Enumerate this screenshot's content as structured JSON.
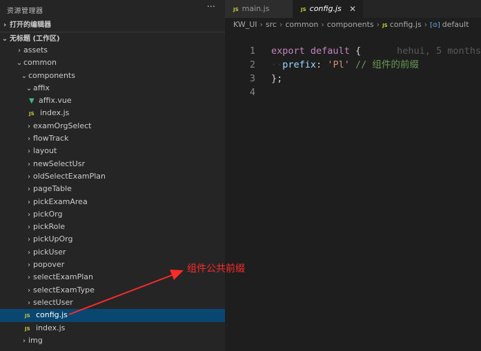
{
  "sidebar": {
    "title": "资源管理器",
    "more_label": "···",
    "open_editors": "打开的编辑器",
    "workspace": "无标题 (工作区)",
    "tree": [
      {
        "label": "assets",
        "kind": "folder",
        "depth": 1,
        "expanded": false
      },
      {
        "label": "common",
        "kind": "folder",
        "depth": 1,
        "expanded": true
      },
      {
        "label": "components",
        "kind": "folder",
        "depth": 2,
        "expanded": true
      },
      {
        "label": "affix",
        "kind": "folder",
        "depth": 3,
        "expanded": true
      },
      {
        "label": "affix.vue",
        "kind": "vue",
        "depth": 4
      },
      {
        "label": "index.js",
        "kind": "js",
        "depth": 4
      },
      {
        "label": "examOrgSelect",
        "kind": "folder",
        "depth": 3,
        "expanded": false
      },
      {
        "label": "flowTrack",
        "kind": "folder",
        "depth": 3,
        "expanded": false
      },
      {
        "label": "layout",
        "kind": "folder",
        "depth": 3,
        "expanded": false
      },
      {
        "label": "newSelectUsr",
        "kind": "folder",
        "depth": 3,
        "expanded": false
      },
      {
        "label": "oldSelectExamPlan",
        "kind": "folder",
        "depth": 3,
        "expanded": false
      },
      {
        "label": "pageTable",
        "kind": "folder",
        "depth": 3,
        "expanded": false
      },
      {
        "label": "pickExamArea",
        "kind": "folder",
        "depth": 3,
        "expanded": false
      },
      {
        "label": "pickOrg",
        "kind": "folder",
        "depth": 3,
        "expanded": false
      },
      {
        "label": "pickRole",
        "kind": "folder",
        "depth": 3,
        "expanded": false
      },
      {
        "label": "pickUpOrg",
        "kind": "folder",
        "depth": 3,
        "expanded": false
      },
      {
        "label": "pickUser",
        "kind": "folder",
        "depth": 3,
        "expanded": false
      },
      {
        "label": "popover",
        "kind": "folder",
        "depth": 3,
        "expanded": false
      },
      {
        "label": "selectExamPlan",
        "kind": "folder",
        "depth": 3,
        "expanded": false
      },
      {
        "label": "selectExamType",
        "kind": "folder",
        "depth": 3,
        "expanded": false
      },
      {
        "label": "selectUser",
        "kind": "folder",
        "depth": 3,
        "expanded": false
      },
      {
        "label": "config.js",
        "kind": "js",
        "depth": 3,
        "selected": true
      },
      {
        "label": "index.js",
        "kind": "js",
        "depth": 3
      },
      {
        "label": "img",
        "kind": "folder",
        "depth": 2,
        "expanded": false
      }
    ]
  },
  "tabs": [
    {
      "label": "main.js",
      "active": false
    },
    {
      "label": "config.js",
      "active": true
    }
  ],
  "breadcrumb": [
    "KW_UI",
    "src",
    "common",
    "components",
    "config.js",
    "default"
  ],
  "editor": {
    "lines": [
      {
        "n": "1",
        "tokens": [
          {
            "t": "export",
            "c": "kw"
          },
          {
            "t": " ",
            "c": "punc"
          },
          {
            "t": "default",
            "c": "kw"
          },
          {
            "t": " {",
            "c": "punc"
          }
        ],
        "blame": "hehui, 5 months"
      },
      {
        "n": "2",
        "tokens": [
          {
            "t": "··",
            "c": "ws"
          },
          {
            "t": "prefix",
            "c": "prop"
          },
          {
            "t": ": ",
            "c": "punc"
          },
          {
            "t": "'Pl'",
            "c": "str"
          },
          {
            "t": " ",
            "c": "punc"
          },
          {
            "t": "// 组件的前缀",
            "c": "cmt"
          }
        ],
        "blame": ""
      },
      {
        "n": "3",
        "tokens": [
          {
            "t": "};",
            "c": "punc"
          }
        ],
        "blame": ""
      },
      {
        "n": "4",
        "tokens": [],
        "blame": ""
      }
    ]
  },
  "annotation": {
    "text": "组件公共前缀",
    "color": "#ff2a2a"
  },
  "icons": {
    "js": "JS",
    "vue": "▼",
    "chevron_right": "›",
    "chevron_down": "⌄",
    "close": "✕",
    "object": "[⊙]"
  }
}
